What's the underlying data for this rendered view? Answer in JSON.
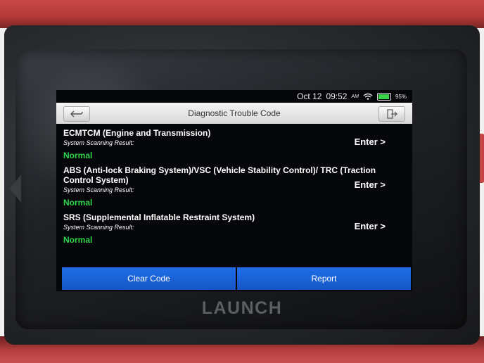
{
  "device": {
    "brand": "LAUNCH"
  },
  "status_bar": {
    "date": "Oct 12",
    "time": "09:52",
    "am_pm": "AM",
    "battery": "95%",
    "battery_level": 0.95,
    "wifi_icon": "wifi-icon",
    "battery_icon": "battery-icon",
    "battery_color": "#39d34a"
  },
  "title_bar": {
    "title": "Diagnostic Trouble Code",
    "back_icon": "back-arrow-icon",
    "exit_icon": "exit-icon"
  },
  "systems": [
    {
      "name": "ECMTCM (Engine and Transmission)",
      "result_label": "System Scanning Result:",
      "status": "Normal",
      "action": "Enter >"
    },
    {
      "name": "ABS (Anti-lock Braking System)/VSC (Vehicle Stability Control)/ TRC (Traction Control System)",
      "result_label": "System Scanning Result:",
      "status": "Normal",
      "action": "Enter >"
    },
    {
      "name": "SRS (Supplemental Inflatable Restraint System)",
      "result_label": "System Scanning Result:",
      "status": "Normal",
      "action": "Enter >"
    }
  ],
  "bottom_bar": {
    "clear_label": "Clear Code",
    "report_label": "Report",
    "accent": "#1f6ee8"
  },
  "colors": {
    "status_normal": "#2cd64b",
    "case_red": "#c24444"
  }
}
